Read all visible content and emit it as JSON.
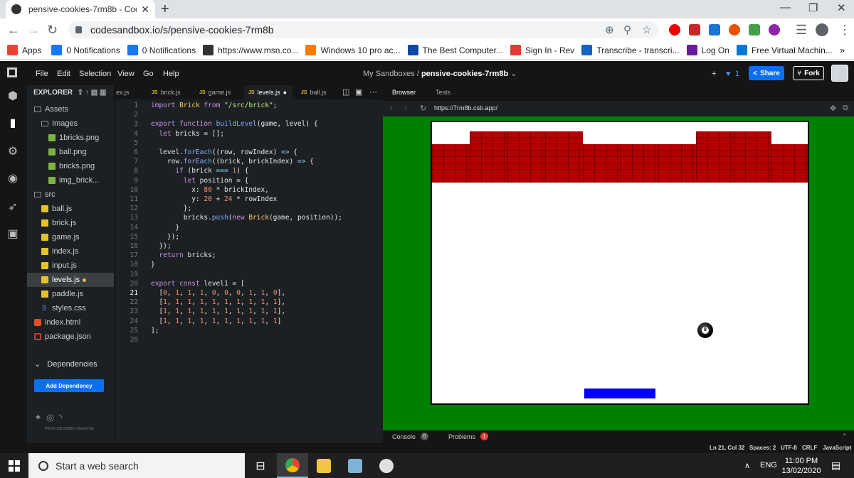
{
  "browser": {
    "tab_title": "pensive-cookies-7rm8b - CodeSandbox",
    "url": "codesandbox.io/s/pensive-cookies-7rm8b",
    "bookmarks": [
      {
        "label": "Apps",
        "color": "#ea4335"
      },
      {
        "label": "0 Notifications",
        "color": "#1877f2"
      },
      {
        "label": "0 Notifications",
        "color": "#1877f2"
      },
      {
        "label": "https://www.msn.co...",
        "color": "#333333"
      },
      {
        "label": "Windows 10 pro ac...",
        "color": "#f57c00"
      },
      {
        "label": "The Best Computer...",
        "color": "#0d47a1"
      },
      {
        "label": "Sign In - Rev",
        "color": "#e53935"
      },
      {
        "label": "Transcribe - transcri...",
        "color": "#1565c0"
      },
      {
        "label": "Log On",
        "color": "#6a1b9a"
      },
      {
        "label": "Free Virtual Machin...",
        "color": "#0078d7"
      }
    ],
    "more_bookmarks": "»"
  },
  "header": {
    "menu": [
      "File",
      "Edit",
      "Selection",
      "View",
      "Go",
      "Help"
    ],
    "crumb_prefix": "My Sandboxes /",
    "sandbox_name": "pensive-cookies-7rm8b",
    "likes": "1",
    "share_label": "Share",
    "fork_label": "Fork"
  },
  "explorer": {
    "title": "EXPLORER",
    "items": [
      {
        "label": "Assets",
        "type": "folder"
      },
      {
        "label": "Images",
        "type": "folder"
      },
      {
        "label": "1bricks.png",
        "type": "img"
      },
      {
        "label": "ball.png",
        "type": "img"
      },
      {
        "label": "bricks.png",
        "type": "img"
      },
      {
        "label": "img_brick...",
        "type": "img"
      },
      {
        "label": "src",
        "type": "folder"
      },
      {
        "label": "ball.js",
        "type": "js"
      },
      {
        "label": "brick.js",
        "type": "js"
      },
      {
        "label": "game.js",
        "type": "js"
      },
      {
        "label": "index.js",
        "type": "js"
      },
      {
        "label": "input.js",
        "type": "js"
      },
      {
        "label": "levels.js",
        "type": "js"
      },
      {
        "label": "paddle.js",
        "type": "js"
      },
      {
        "label": "styles.css",
        "type": "css"
      },
      {
        "label": "index.html",
        "type": "html"
      },
      {
        "label": "package.json",
        "type": "pkg"
      }
    ],
    "dependencies_label": "Dependencies",
    "add_dependency_label": "Add Dependency",
    "build_id": "PROD-1581526537-f8e9107a2"
  },
  "editor": {
    "tabs": [
      "ex.js",
      "brick.js",
      "game.js",
      "levels.js",
      "ball.js"
    ],
    "active_tab": "levels.js",
    "current_line": 21,
    "lines": [
      "import Brick from \"/src/brick\";",
      "",
      "export function buildLevel(game, level) {",
      "  let bricks = [];",
      "",
      "  level.forEach((row, rowIndex) => {",
      "    row.forEach((brick, brickIndex) => {",
      "      if (brick === 1) {",
      "        let position = {",
      "          x: 80 * brickIndex,",
      "          y: 20 + 24 * rowIndex",
      "        };",
      "        bricks.push(new Brick(game, position));",
      "      }",
      "    });",
      "  });",
      "  return bricks;",
      "}",
      "",
      "export const level1 = [",
      "  [0, 1, 1, 1, 0, 0, 0, 1, 1, 0],",
      "  [1, 1, 1, 1, 1, 1, 1, 1, 1, 1],",
      "  [1, 1, 1, 1, 1, 1, 1, 1, 1, 1],",
      "  [1, 1, 1, 1, 1, 1, 1, 1, 1, 1]",
      "];",
      ""
    ]
  },
  "preview": {
    "tabs": [
      "Browser",
      "Tests"
    ],
    "url": "https://7rm8b.csb.app/",
    "level": [
      [
        0,
        1,
        1,
        1,
        0,
        0,
        0,
        1,
        1,
        0
      ],
      [
        1,
        1,
        1,
        1,
        1,
        1,
        1,
        1,
        1,
        1
      ],
      [
        1,
        1,
        1,
        1,
        1,
        1,
        1,
        1,
        1,
        1
      ],
      [
        1,
        1,
        1,
        1,
        1,
        1,
        1,
        1,
        1,
        1
      ]
    ],
    "ball_number": "8",
    "console_label": "Console",
    "console_count": "0",
    "problems_label": "Problems",
    "problems_count": "1"
  },
  "status": {
    "cursor": "Ln 21, Col 32",
    "spaces": "Spaces: 2",
    "encoding": "UTF-8",
    "eol": "CRLF",
    "language": "JavaScript"
  },
  "taskbar": {
    "search_placeholder": "Start a web search",
    "language": "ENG",
    "time": "11:00 PM",
    "date": "13/02/2020"
  }
}
